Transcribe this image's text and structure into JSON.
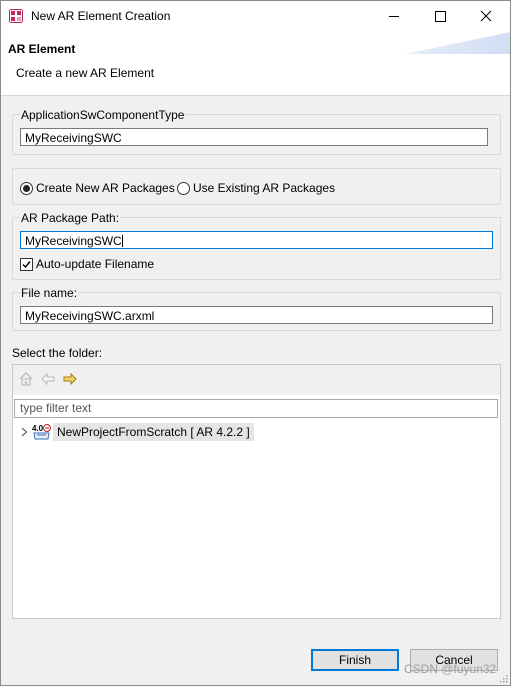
{
  "window": {
    "title": "New AR Element Creation"
  },
  "header": {
    "title": "AR Element",
    "description": "Create a new AR Element"
  },
  "component_type": {
    "label": "ApplicationSwComponentType",
    "value": "MyReceivingSWC"
  },
  "packages": {
    "create_new_label": "Create New AR Packages",
    "use_existing_label": "Use Existing AR Packages",
    "selected": "create_new"
  },
  "package_path": {
    "label": "AR Package Path:",
    "value": "MyReceivingSWC",
    "auto_update_label": "Auto-update Filename",
    "auto_update_checked": true
  },
  "file_name": {
    "label": "File name:",
    "value": "MyReceivingSWC.arxml"
  },
  "folder": {
    "label": "Select the folder:",
    "filter_placeholder": "type filter text",
    "tree": [
      {
        "label": "NewProjectFromScratch [ AR 4.2.2 ]",
        "icon": "autosar-project-icon"
      }
    ]
  },
  "buttons": {
    "finish": "Finish",
    "cancel": "Cancel"
  },
  "watermark": "CSDN @fuyun32",
  "colors": {
    "accent": "#0078d7",
    "selection": "#e5e5e5",
    "background": "#f0f0f0"
  }
}
